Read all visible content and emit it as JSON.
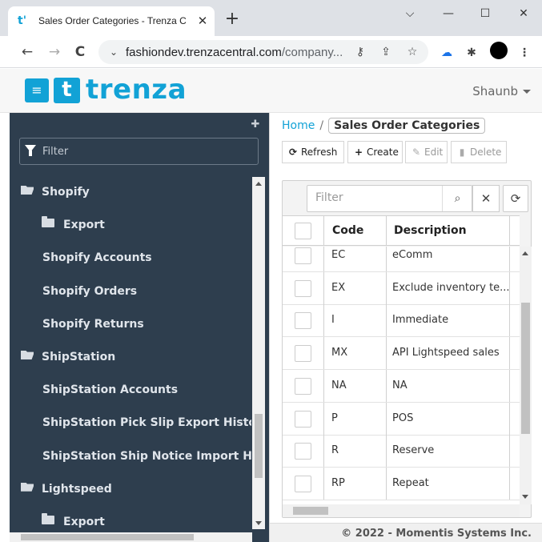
{
  "browser": {
    "tab_title": "Sales Order Categories - Trenza C",
    "tab_favicon": "t'",
    "tab_close": "✕",
    "new_tab": "+",
    "minimize": "—",
    "maximize": "☐",
    "close": "✕",
    "url_host": "fashiondev.trenzacentral.com",
    "url_path": "/company...",
    "nav_back": "←",
    "nav_forward": "→",
    "nav_reload": "C",
    "menu_dots": "⋮"
  },
  "app": {
    "logo_letter": "t",
    "logo_text": "trenza",
    "menu_icon": "≡",
    "user": "Shaunb"
  },
  "sidebar": {
    "filter_placeholder": "Filter",
    "pin_icon": "✚",
    "items": [
      {
        "label": "Shopify",
        "type": "folder-open",
        "indent": 0
      },
      {
        "label": "Export",
        "type": "folder",
        "indent": 1
      },
      {
        "label": "Shopify Accounts",
        "type": "page",
        "indent": 1
      },
      {
        "label": "Shopify Orders",
        "type": "page",
        "indent": 1
      },
      {
        "label": "Shopify Returns",
        "type": "page",
        "indent": 1
      },
      {
        "label": "ShipStation",
        "type": "folder-open",
        "indent": 0
      },
      {
        "label": "ShipStation Accounts",
        "type": "page",
        "indent": 1
      },
      {
        "label": "ShipStation Pick Slip Export History",
        "type": "page",
        "indent": 1
      },
      {
        "label": "ShipStation Ship Notice Import History",
        "type": "page",
        "indent": 1
      },
      {
        "label": "Lightspeed",
        "type": "folder-open",
        "indent": 0
      },
      {
        "label": "Export",
        "type": "folder",
        "indent": 1
      }
    ]
  },
  "main": {
    "breadcrumb_home": "Home",
    "breadcrumb_sep": "/",
    "breadcrumb_current": "Sales Order Categories",
    "toolbar": {
      "refresh": "Refresh",
      "create": "Create",
      "edit": "Edit",
      "delete": "Delete"
    },
    "grid": {
      "filter_placeholder": "Filter",
      "columns": [
        "Code",
        "Description"
      ],
      "rows": [
        {
          "code": "EC",
          "description": "eComm"
        },
        {
          "code": "EX",
          "description": "Exclude inventory te..."
        },
        {
          "code": "I",
          "description": "Immediate"
        },
        {
          "code": "MX",
          "description": "API Lightspeed sales"
        },
        {
          "code": "NA",
          "description": "NA"
        },
        {
          "code": "P",
          "description": "POS"
        },
        {
          "code": "R",
          "description": "Reserve"
        },
        {
          "code": "RP",
          "description": "Repeat"
        }
      ]
    },
    "footer": "© 2022 - Momentis Systems Inc."
  },
  "colors": {
    "brand": "#12a2d6",
    "sidebar_bg": "#2e3e4e"
  }
}
